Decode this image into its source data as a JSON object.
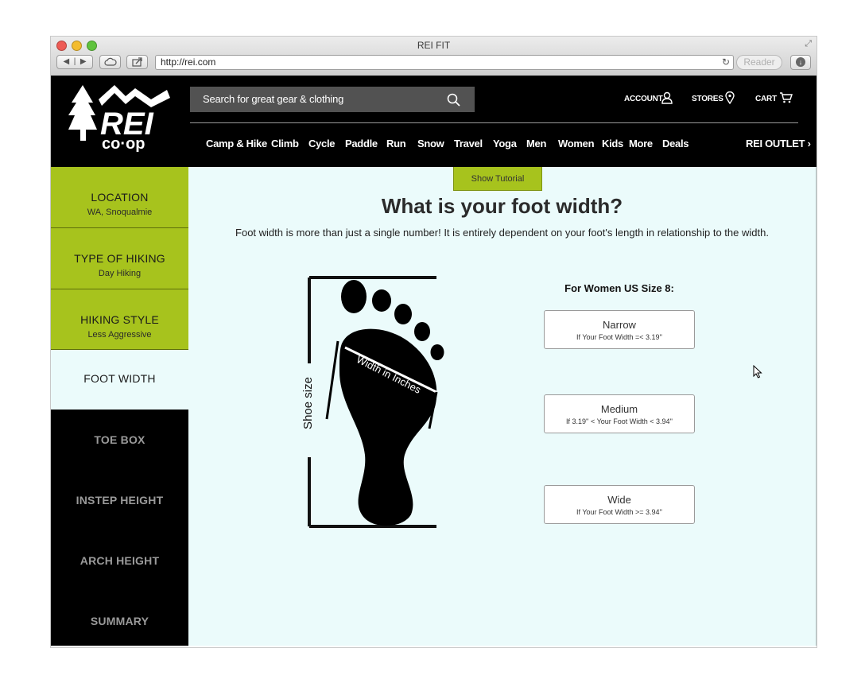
{
  "browser": {
    "title": "REI FIT",
    "url": "http://rei.com",
    "reader_label": "Reader"
  },
  "header": {
    "search_placeholder": "Search for great gear & clothing",
    "account_label": "ACCOUNT",
    "stores_label": "STORES",
    "cart_label": "CART",
    "nav": [
      "Camp & Hike",
      "Climb",
      "Cycle",
      "Paddle",
      "Run",
      "Snow",
      "Travel",
      "Yoga",
      "Men",
      "Women",
      "Kids",
      "More",
      "Deals"
    ],
    "outlet_label": "REI OUTLET"
  },
  "sidebar": {
    "steps": [
      {
        "title": "LOCATION",
        "value": "WA, Snoqualmie",
        "state": "completed"
      },
      {
        "title": "TYPE OF HIKING",
        "value": "Day Hiking",
        "state": "completed"
      },
      {
        "title": "HIKING STYLE",
        "value": "Less Aggressive",
        "state": "completed"
      },
      {
        "title": "FOOT WIDTH",
        "state": "active"
      },
      {
        "title": "TOE BOX",
        "state": "pending"
      },
      {
        "title": "INSTEP HEIGHT",
        "state": "pending"
      },
      {
        "title": "ARCH HEIGHT",
        "state": "pending"
      },
      {
        "title": "SUMMARY",
        "state": "pending"
      }
    ]
  },
  "main": {
    "tutorial_label": "Show Tutorial",
    "heading": "What is your foot width?",
    "description": "Foot width is more than just a single number! It is entirely dependent on your foot's length in relationship to the width.",
    "diagram": {
      "shoe_size_label": "Shoe size",
      "width_label": "Width in Inches"
    },
    "size_label": "For Women US Size 8:",
    "options": [
      {
        "label": "Narrow",
        "detail": "If Your Foot Width =< 3.19''"
      },
      {
        "label": "Medium",
        "detail": "If 3.19'' < Your Foot Width < 3.94''"
      },
      {
        "label": "Wide",
        "detail": "If Your Foot Width >= 3.94''"
      }
    ]
  },
  "colors": {
    "brand_green": "#a7c31d",
    "header_black": "#000000",
    "content_bg": "#ebfbfb"
  }
}
